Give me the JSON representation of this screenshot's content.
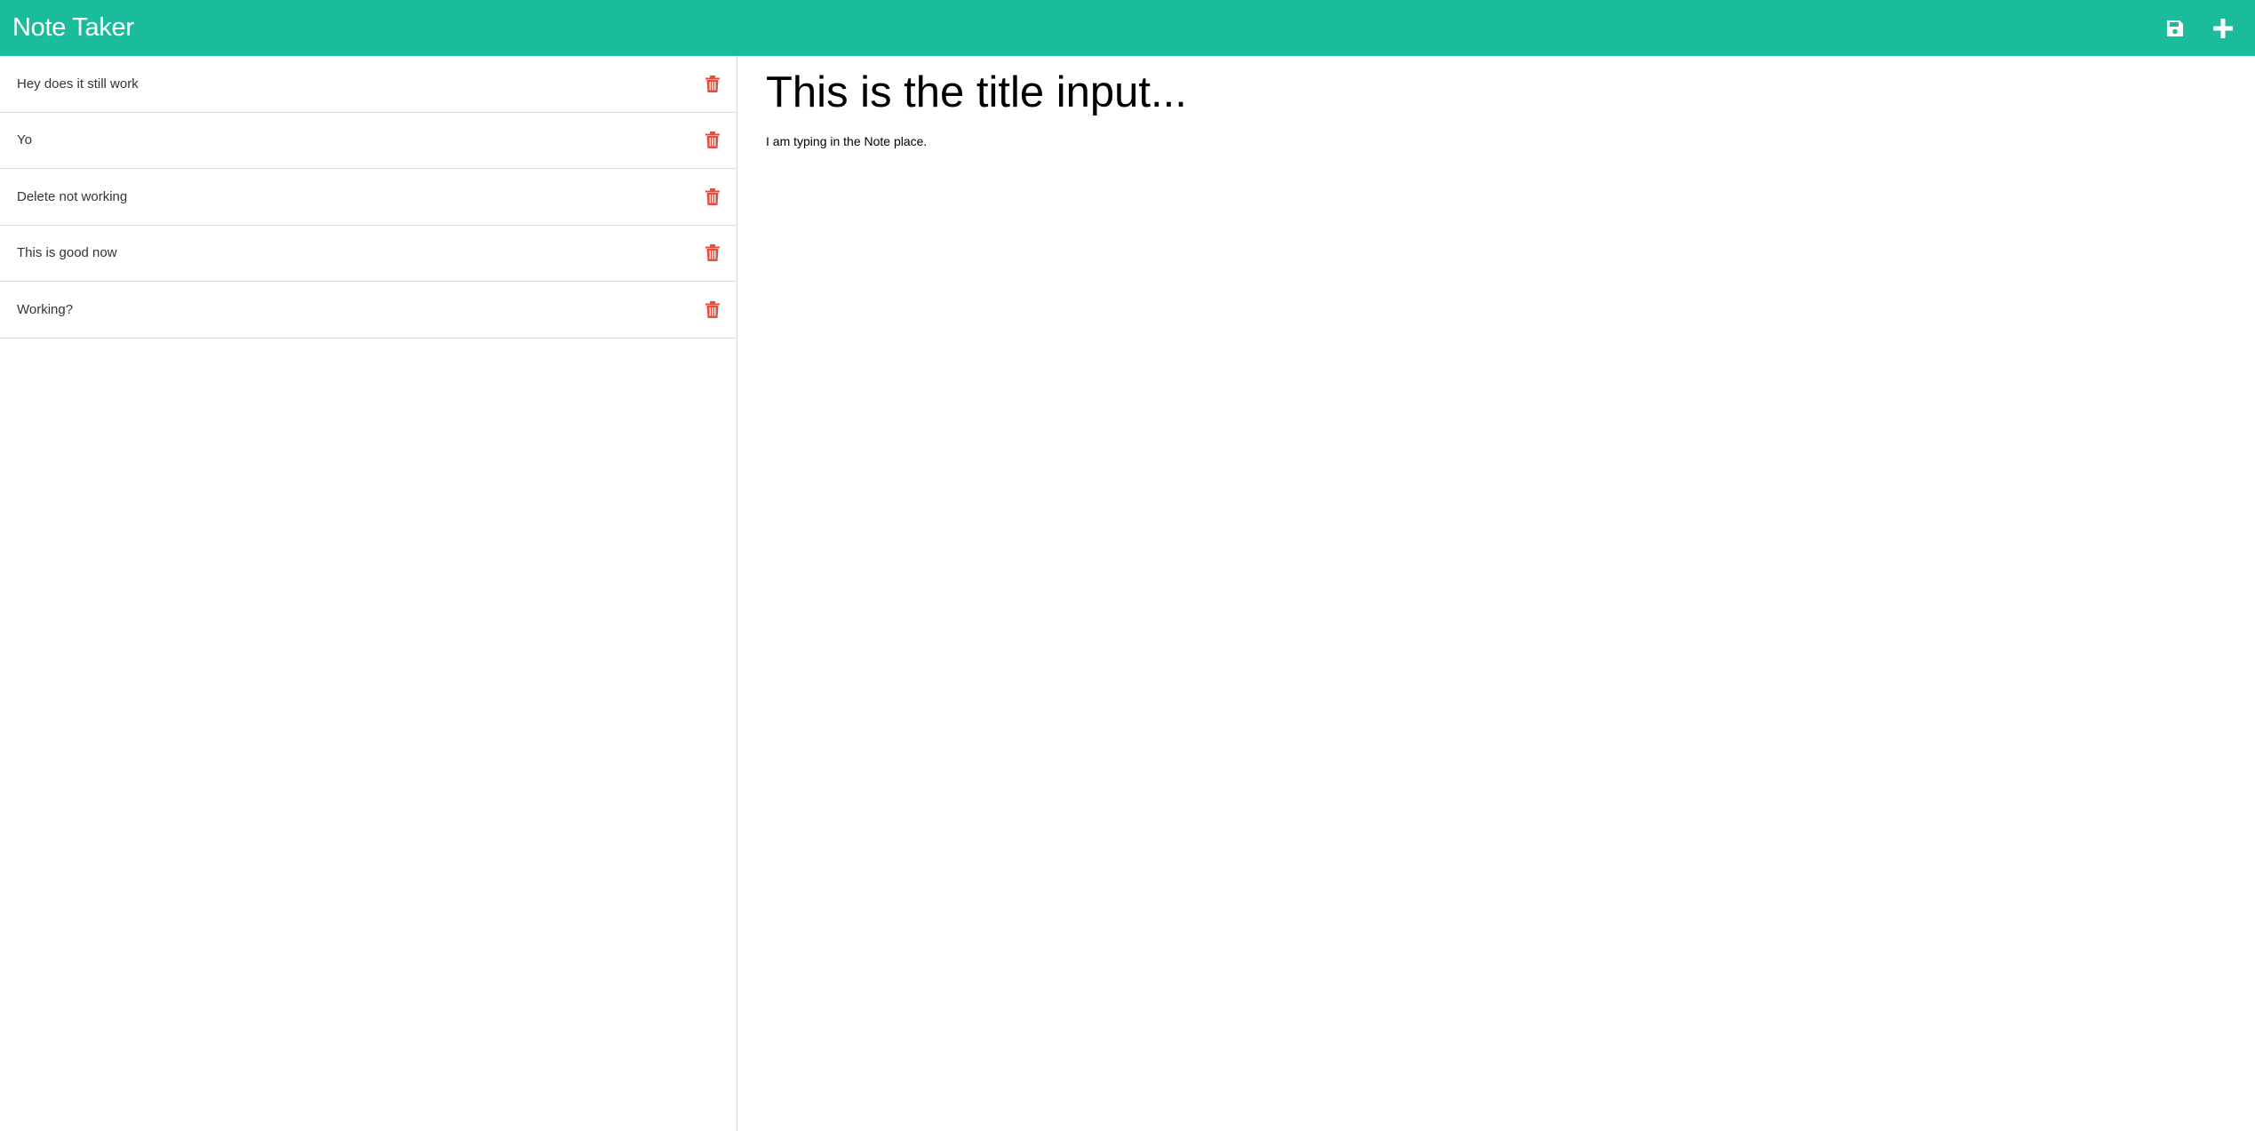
{
  "app": {
    "title": "Note Taker",
    "accent_color": "#1abc9c",
    "delete_color": "#e74c3c"
  },
  "toolbar": {
    "save_icon": "floppy-disk-save-icon",
    "new_icon": "plus-new-note-icon"
  },
  "notes": [
    {
      "title": "Hey does it still work",
      "delete_icon": "trash-icon"
    },
    {
      "title": "Yo",
      "delete_icon": "trash-icon"
    },
    {
      "title": "Delete not working",
      "delete_icon": "trash-icon"
    },
    {
      "title": "This is good now",
      "delete_icon": "trash-icon"
    },
    {
      "title": "Working?",
      "delete_icon": "trash-icon"
    }
  ],
  "editor": {
    "title_value": "This is the title input...",
    "text_value": "I am typing in the Note place."
  }
}
